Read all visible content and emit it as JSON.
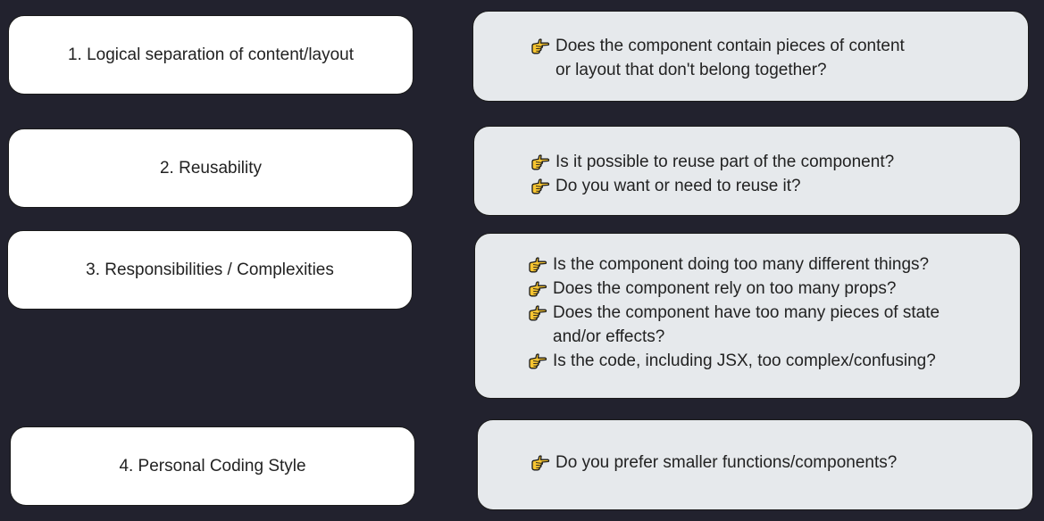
{
  "colors": {
    "background": "#22222e",
    "left_card": "#ffffff",
    "right_card": "#e6e9ec",
    "icon_fill": "#f7c531",
    "icon_stroke": "#1a1a1a"
  },
  "rows": [
    {
      "label": "1. Logical separation of content/layout",
      "questions": [
        {
          "icon": "pointing-hand-icon",
          "text": "Does the component contain pieces of content\n or layout that don't belong together?"
        }
      ]
    },
    {
      "label": "2. Reusability",
      "questions": [
        {
          "icon": "pointing-hand-icon",
          "text": "Is it possible to reuse part of the component?"
        },
        {
          "icon": "pointing-hand-icon",
          "text": "Do you want or need to reuse it?"
        }
      ]
    },
    {
      "label": "3. Responsibilities / Complexities",
      "questions": [
        {
          "icon": "pointing-hand-icon",
          "text": "Is the component doing too many different things?"
        },
        {
          "icon": "pointing-hand-icon",
          "text": "Does the component rely on too many props?"
        },
        {
          "icon": "pointing-hand-icon",
          "text": "Does the component have too many pieces of state\nand/or effects?"
        },
        {
          "icon": "pointing-hand-icon",
          "text": "Is the code, including JSX, too complex/confusing?"
        }
      ]
    },
    {
      "label": "4. Personal Coding Style",
      "questions": [
        {
          "icon": "pointing-hand-icon",
          "text": "Do you prefer smaller functions/components?"
        }
      ]
    }
  ]
}
